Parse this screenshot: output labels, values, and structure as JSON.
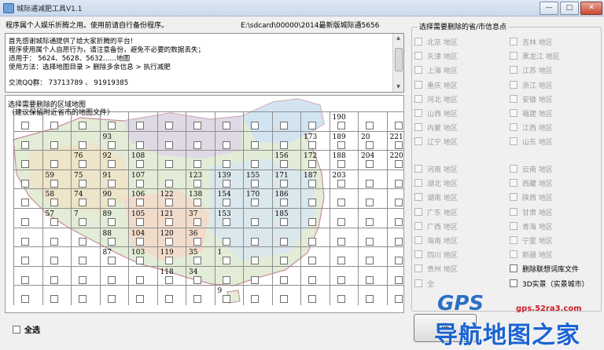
{
  "window": {
    "title": "城际通减肥工具V1.1",
    "minimize": "—",
    "maximize": "□",
    "close": "✕"
  },
  "info": {
    "notice": "程序属个人娱乐折腾之用。使用前请自行备份程序。",
    "path": "E:\\sdcard\\00000\\2014最新版城际通5656"
  },
  "description": [
    "首先感谢城际通提供了给大家折腾的平台!",
    "程序使用属个人自愿行为，请注意备份，避免不必要的数据丢失；",
    "适用于： 5624、5628、5632……地图",
    "使用方法：选择地图目录 > 删除多余信息 > 执行减肥",
    "",
    "交流QQ群： 73713789 、 91919385"
  ],
  "map": {
    "title_line1": "选择需要删除的区域地图",
    "title_line2": "（建议保留附近省市的地图文件）",
    "labels": [
      {
        "t": "190",
        "c": 11,
        "r": 0
      },
      {
        "t": "93",
        "c": 3,
        "r": 1
      },
      {
        "t": "173",
        "c": 10,
        "r": 1
      },
      {
        "t": "189",
        "c": 11,
        "r": 1
      },
      {
        "t": "20",
        "c": 12,
        "r": 1
      },
      {
        "t": "221",
        "c": 13,
        "r": 1
      },
      {
        "t": "76",
        "c": 2,
        "r": 2
      },
      {
        "t": "92",
        "c": 3,
        "r": 2
      },
      {
        "t": "108",
        "c": 4,
        "r": 2
      },
      {
        "t": "156",
        "c": 9,
        "r": 2
      },
      {
        "t": "172",
        "c": 10,
        "r": 2
      },
      {
        "t": "188",
        "c": 11,
        "r": 2
      },
      {
        "t": "204",
        "c": 12,
        "r": 2
      },
      {
        "t": "220",
        "c": 13,
        "r": 2
      },
      {
        "t": "59",
        "c": 1,
        "r": 3
      },
      {
        "t": "75",
        "c": 2,
        "r": 3
      },
      {
        "t": "91",
        "c": 3,
        "r": 3
      },
      {
        "t": "107",
        "c": 4,
        "r": 3
      },
      {
        "t": "123",
        "c": 6,
        "r": 3
      },
      {
        "t": "139",
        "c": 7,
        "r": 3
      },
      {
        "t": "155",
        "c": 8,
        "r": 3
      },
      {
        "t": "171",
        "c": 9,
        "r": 3
      },
      {
        "t": "187",
        "c": 10,
        "r": 3
      },
      {
        "t": "203",
        "c": 11,
        "r": 3
      },
      {
        "t": "58",
        "c": 1,
        "r": 4
      },
      {
        "t": "74",
        "c": 2,
        "r": 4
      },
      {
        "t": "90",
        "c": 3,
        "r": 4
      },
      {
        "t": "106",
        "c": 4,
        "r": 4
      },
      {
        "t": "122",
        "c": 5,
        "r": 4
      },
      {
        "t": "138",
        "c": 6,
        "r": 4
      },
      {
        "t": "154",
        "c": 7,
        "r": 4
      },
      {
        "t": "170",
        "c": 8,
        "r": 4
      },
      {
        "t": "186",
        "c": 9,
        "r": 4
      },
      {
        "t": "57",
        "c": 1,
        "r": 5
      },
      {
        "t": "7",
        "c": 2,
        "r": 5
      },
      {
        "t": "89",
        "c": 3,
        "r": 5
      },
      {
        "t": "105",
        "c": 4,
        "r": 5
      },
      {
        "t": "121",
        "c": 5,
        "r": 5
      },
      {
        "t": "37",
        "c": 6,
        "r": 5
      },
      {
        "t": "153",
        "c": 7,
        "r": 5
      },
      {
        "t": "185",
        "c": 9,
        "r": 5
      },
      {
        "t": "88",
        "c": 3,
        "r": 6
      },
      {
        "t": "104",
        "c": 4,
        "r": 6
      },
      {
        "t": "120",
        "c": 5,
        "r": 6
      },
      {
        "t": "36",
        "c": 6,
        "r": 6
      },
      {
        "t": "87",
        "c": 3,
        "r": 7
      },
      {
        "t": "103",
        "c": 4,
        "r": 7
      },
      {
        "t": "119",
        "c": 5,
        "r": 7
      },
      {
        "t": "35",
        "c": 6,
        "r": 7
      },
      {
        "t": "1",
        "c": 7,
        "r": 7
      },
      {
        "t": "118",
        "c": 5,
        "r": 8
      },
      {
        "t": "34",
        "c": 6,
        "r": 8
      },
      {
        "t": "9",
        "c": 7,
        "r": 9
      }
    ]
  },
  "select_all": "全选",
  "provinces": {
    "title": "选择需要删除的省/市信息点",
    "left": [
      "北京 地区",
      "天津 地区",
      "上海 地区",
      "重庆 地区",
      "河北 地区",
      "山西 地区",
      "内蒙 地区",
      "辽宁 地区",
      "河南 地区",
      "湖北 地区",
      "湖南 地区",
      "广东 地区",
      "广西 地区",
      "海南 地区",
      "四川 地区",
      "贵州 地区",
      "全"
    ],
    "right": [
      "吉林 地区",
      "黑龙江 地区",
      "江苏 地区",
      "浙江 地区",
      "安徽 地区",
      "福建 地区",
      "江西 地区",
      "山东 地区",
      "云南 地区",
      "西藏 地区",
      "陕西 地区",
      "甘肃 地区",
      "青海 地区",
      "宁夏 地区",
      "新疆 地区",
      "删除联想词库文件",
      "3D实景（实景城市）"
    ]
  },
  "execute_button": "确",
  "watermark": {
    "gps": "GPS",
    "url": "gps.52ra3.com",
    "cn": "导航地图之家"
  }
}
